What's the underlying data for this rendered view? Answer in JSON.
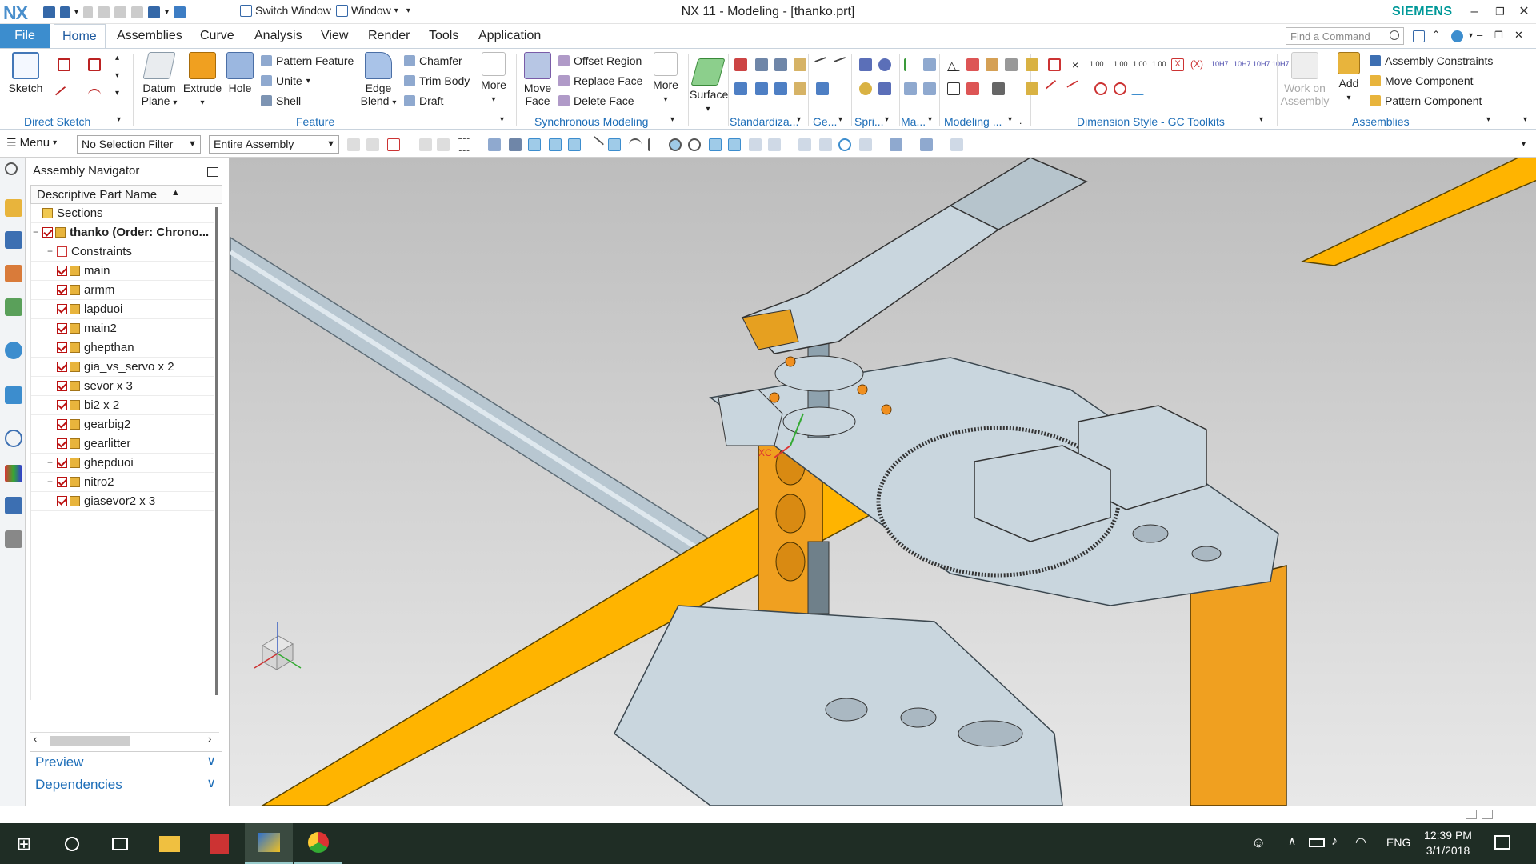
{
  "titlebar": {
    "logo": "NX",
    "switch_window": "Switch Window",
    "window": "Window",
    "title": "NX 11 - Modeling - [thanko.prt]",
    "brand": "SIEMENS",
    "minimize": "–",
    "restore": "❐",
    "close": "✕"
  },
  "menu": {
    "file": "File",
    "tabs": [
      "Home",
      "Assemblies",
      "Curve",
      "Analysis",
      "View",
      "Render",
      "Tools",
      "Application"
    ],
    "find_placeholder": "Find a Command"
  },
  "ribbon": {
    "sketch": "Sketch",
    "datum_plane": "Datum Plane",
    "extrude": "Extrude",
    "hole": "Hole",
    "pattern_feature": "Pattern Feature",
    "unite": "Unite",
    "shell": "Shell",
    "edge_blend": "Edge Blend",
    "chamfer": "Chamfer",
    "trim_body": "Trim Body",
    "draft": "Draft",
    "more1": "More",
    "move_face": "Move Face",
    "offset_region": "Offset Region",
    "replace_face": "Replace Face",
    "delete_face": "Delete Face",
    "more2": "More",
    "surface": "Surface",
    "work_on_assembly": "Work on Assembly",
    "add": "Add",
    "assembly_constraints": "Assembly Constraints",
    "move_component": "Move Component",
    "pattern_component": "Pattern Component",
    "groups": {
      "direct_sketch": "Direct Sketch",
      "feature": "Feature",
      "synchronous": "Synchronous Modeling",
      "standardiza": "Standardiza...",
      "ge": "Ge...",
      "spri": "Spri...",
      "ma": "Ma...",
      "modeling": "Modeling ...",
      "dim_style": "Dimension Style - GC Toolkits",
      "assemblies": "Assemblies"
    }
  },
  "selbar": {
    "menu": "Menu",
    "selection_filter": "No Selection Filter",
    "scope": "Entire Assembly"
  },
  "navigator": {
    "title": "Assembly Navigator",
    "column": "Descriptive Part Name",
    "items": [
      {
        "label": "Sections",
        "level": 0,
        "kind": "folder"
      },
      {
        "label": "thanko (Order: Chrono...",
        "level": 0,
        "kind": "root"
      },
      {
        "label": "Constraints",
        "level": 1,
        "kind": "constraints"
      },
      {
        "label": "main",
        "level": 1,
        "kind": "part"
      },
      {
        "label": "armm",
        "level": 1,
        "kind": "part"
      },
      {
        "label": "lapduoi",
        "level": 1,
        "kind": "part"
      },
      {
        "label": "main2",
        "level": 1,
        "kind": "part"
      },
      {
        "label": "ghepthan",
        "level": 1,
        "kind": "part"
      },
      {
        "label": "gia_vs_servo x 2",
        "level": 1,
        "kind": "part"
      },
      {
        "label": "sevor x 3",
        "level": 1,
        "kind": "part"
      },
      {
        "label": "bi2 x 2",
        "level": 1,
        "kind": "part"
      },
      {
        "label": "gearbig2",
        "level": 1,
        "kind": "part"
      },
      {
        "label": "gearlitter",
        "level": 1,
        "kind": "part"
      },
      {
        "label": "ghepduoi",
        "level": 1,
        "kind": "subassy"
      },
      {
        "label": "nitro2",
        "level": 1,
        "kind": "subassy"
      },
      {
        "label": "giasevor2 x 3",
        "level": 1,
        "kind": "part"
      }
    ],
    "preview": "Preview",
    "dependencies": "Dependencies"
  },
  "viewport": {
    "triad_label": "XC"
  },
  "taskbar": {
    "time": "12:39 PM",
    "date": "3/1/2018",
    "lang": "ENG"
  },
  "colors": {
    "accent": "#3c8dce",
    "blade": "#ffb400",
    "frame": "#f0a020",
    "metal": "#c9d6de",
    "taskbar": "#1f2d25"
  }
}
